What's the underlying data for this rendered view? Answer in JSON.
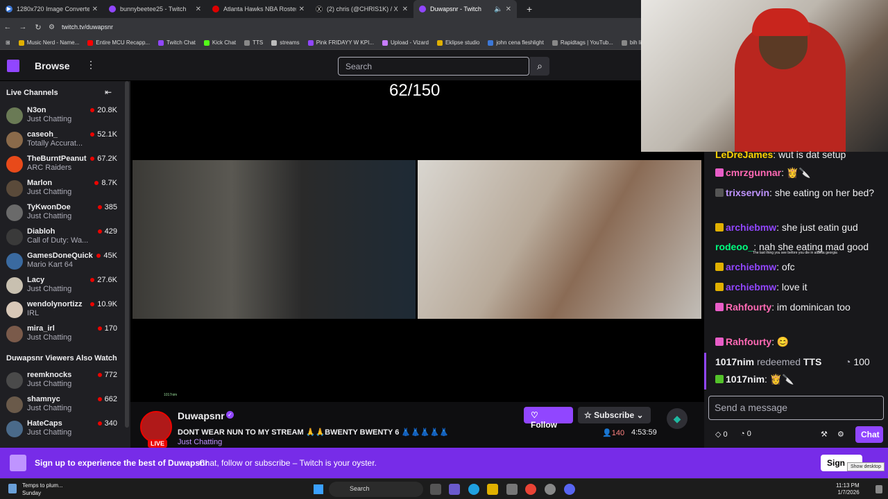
{
  "browser": {
    "tabs": [
      {
        "label": "1280x720 Image Converter | Fr",
        "color": "#3c78d8"
      },
      {
        "label": "bunnybeetee25 - Twitch",
        "color": "#9146ff"
      },
      {
        "label": "Atlanta Hawks NBA Roster - ESP",
        "color": "#d00"
      },
      {
        "label": "(2) chris (@CHRIS1K) / X",
        "color": "#000"
      },
      {
        "label": "Duwapsnr - Twitch",
        "color": "#9146ff"
      }
    ],
    "url": "twitch.tv/duwapsnr",
    "bookmarks": [
      {
        "label": "Music Nerd - Name...",
        "color": "#e0b000"
      },
      {
        "label": "Entire MCU Recapp...",
        "color": "#f00"
      },
      {
        "label": "Twitch Chat",
        "color": "#9146ff"
      },
      {
        "label": "Kick Chat",
        "color": "#53fc18"
      },
      {
        "label": "TTS",
        "color": "#888"
      },
      {
        "label": "streams",
        "color": "#bbb"
      },
      {
        "label": "Pink FRIDAYY W KPI...",
        "color": "#9146ff"
      },
      {
        "label": "Upload - Vizard",
        "color": "#c77dff"
      },
      {
        "label": "Eklipse studio",
        "color": "#e0b000"
      },
      {
        "label": "john cena fleshlight",
        "color": "#3c78d8"
      },
      {
        "label": "Rapidtags | YouTub...",
        "color": "#888"
      },
      {
        "label": "bih links",
        "color": "#888"
      }
    ]
  },
  "nav": {
    "browse": "Browse",
    "search_placeholder": "Search"
  },
  "sidebar": {
    "live_header": "Live Channels",
    "also_watch_header": "Duwapsnr Viewers Also Watch",
    "channels": [
      {
        "name": "N3on",
        "category": "Just Chatting",
        "viewers": "20.8K",
        "color": "#6a7a55"
      },
      {
        "name": "caseoh_",
        "category": "Totally Accurat...",
        "viewers": "52.1K",
        "color": "#8a6a4a"
      },
      {
        "name": "TheBurntPeanut",
        "category": "ARC Raiders",
        "viewers": "67.2K",
        "color": "#e84a1a"
      },
      {
        "name": "Marlon",
        "category": "Just Chatting",
        "viewers": "8.7K",
        "color": "#5a4a3a"
      },
      {
        "name": "TyKwonDoe",
        "category": "Just Chatting",
        "viewers": "385",
        "color": "#6a6a6a"
      },
      {
        "name": "Diabloh",
        "category": "Call of Duty: Wa...",
        "viewers": "429",
        "color": "#3a3a3a"
      },
      {
        "name": "GamesDoneQuick",
        "category": "Mario Kart 64",
        "viewers": "45K",
        "color": "#3a6aa0"
      },
      {
        "name": "Lacy",
        "category": "Just Chatting",
        "viewers": "27.6K",
        "color": "#c8c0b0"
      },
      {
        "name": "wendolynortizz",
        "category": "IRL",
        "viewers": "10.9K",
        "color": "#d8c8b8"
      },
      {
        "name": "mira_irl",
        "category": "Just Chatting",
        "viewers": "170",
        "color": "#7a5a4a"
      }
    ],
    "also_watch": [
      {
        "name": "reemknocks",
        "category": "Just Chatting",
        "viewers": "772",
        "color": "#4a4a4a"
      },
      {
        "name": "shamnyc",
        "category": "Just Chatting",
        "viewers": "662",
        "color": "#6a5a4a"
      },
      {
        "name": "HateCaps",
        "category": "Just Chatting",
        "viewers": "340",
        "color": "#4a6a8a"
      }
    ]
  },
  "player": {
    "counter": "62/150",
    "tiny_text": "1017nim"
  },
  "stream": {
    "name": "Duwapsnr",
    "live": "LIVE",
    "title": "DONT WEAR NUN TO MY STREAM 🙏🙏BWENTY BWENTY 6 👗👗👗👗👗",
    "category": "Just Chatting",
    "follow": "Follow",
    "subscribe": "Subscribe",
    "viewers": "140",
    "uptime": "4:53:59"
  },
  "chat": {
    "messages": [
      {
        "user": "LeDreJames",
        "color": "#ffd400",
        "text": "wut is dat setup"
      },
      {
        "user": "cmrzgunnar",
        "color": "#ff69b4",
        "text": "👸🔪"
      },
      {
        "user": "trixservin",
        "color": "#bf94ff",
        "text": "she eating on her bed?"
      },
      {
        "user": "archiebmw",
        "color": "#9146ff",
        "text": "she just eatin gud"
      },
      {
        "user": "rodeoo_",
        "color": "#00ff7f",
        "text": "nah she eating mad good"
      },
      {
        "user": "archiebmw",
        "color": "#9146ff",
        "text": "ofc"
      },
      {
        "user": "archiebmw",
        "color": "#9146ff",
        "text": "love it"
      },
      {
        "user": "Rahfourty",
        "color": "#ff69b4",
        "text": "im dominican too"
      },
      {
        "user": "Rahfourty",
        "color": "#ff69b4",
        "text": "😊"
      }
    ],
    "overlay_note": "The last thing you see before you die in atlanta georgia",
    "redeem_user": "1017nim",
    "redeem_text": "redeemed",
    "redeem_reward": "TTS",
    "redeem_cost": "100",
    "redeem_msg_user": "1017nim",
    "redeem_msg_text": "👸🔪",
    "input_placeholder": "Send a message",
    "bits": "0",
    "points": "0",
    "chat_button": "Chat"
  },
  "banner": {
    "main": "Sign up to experience the best of Duwapsnr",
    "sub": "Chat, follow or subscribe – Twitch is your oyster.",
    "sign": "Sign",
    "tooltip": "Show desktop"
  },
  "taskbar": {
    "weather_line1": "Temps to plum...",
    "weather_line2": "Sunday",
    "search": "Search",
    "time": "11:13 PM",
    "date": "1/7/2026"
  }
}
